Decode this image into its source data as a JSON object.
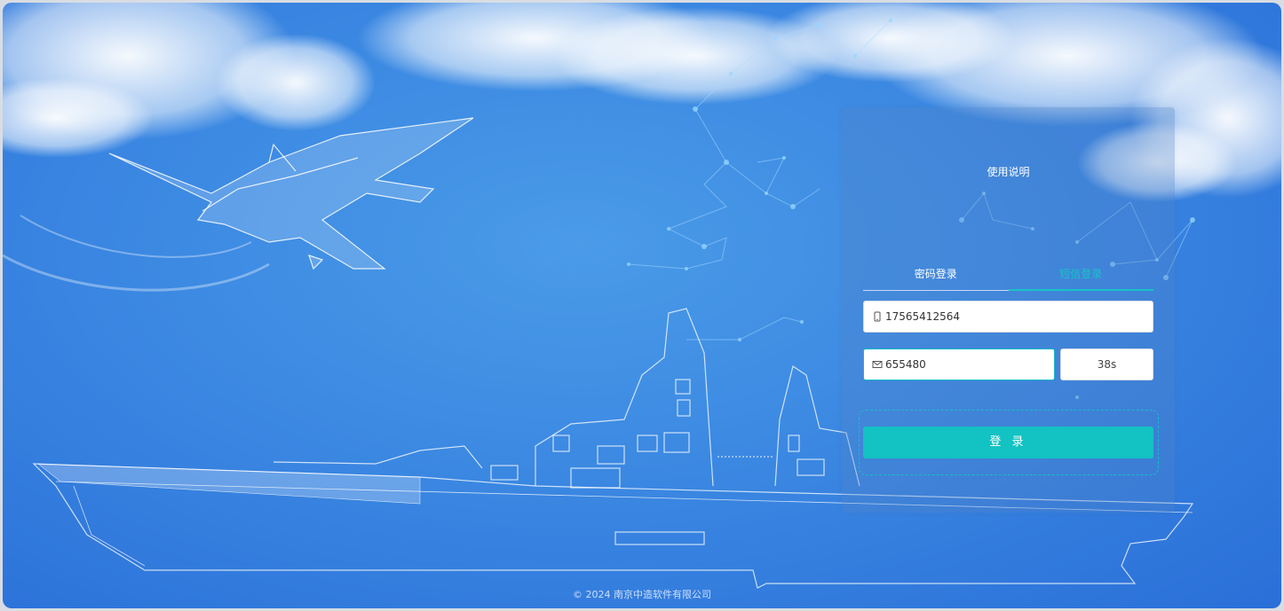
{
  "panel": {
    "help_link": "使用说明",
    "tabs": [
      "密码登录",
      "短信登录"
    ],
    "active_tab_index": 1,
    "phone_value": "17565412564",
    "code_value": "655480",
    "countdown_label": "38s",
    "login_label": "登 录"
  },
  "footer": {
    "copyright": "© 2024 南京中造软件有限公司"
  },
  "icons": {
    "phone": "mobile-icon",
    "code": "mail-icon"
  },
  "colors": {
    "accent": "#13c2c2",
    "background": "#3b88e2"
  }
}
